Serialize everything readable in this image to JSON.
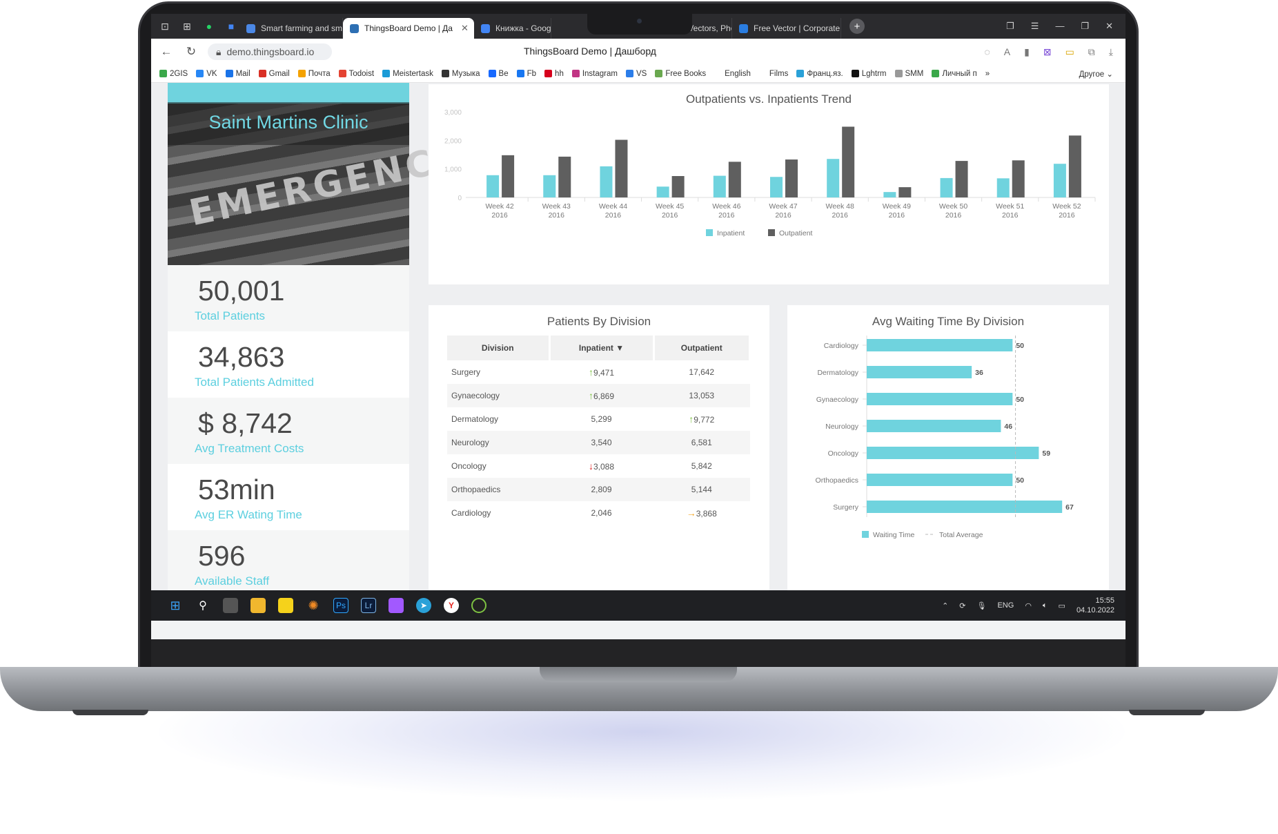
{
  "browser": {
    "tabs": [
      {
        "label": "Smart farming and smart a",
        "color": "#4b88e6"
      },
      {
        "label": "ThingsBoard Demo | Да",
        "color": "#2d6fb3"
      },
      {
        "label": "Книжка - Google",
        "color": "#4285f4"
      },
      {
        "label": "ort Vectors, Pho",
        "color": "#666"
      },
      {
        "label": "Free Vector | Corporate con",
        "color": "#2a7de1"
      }
    ],
    "url": "demo.thingsboard.io",
    "page_title": "ThingsBoard Demo | Дашборд",
    "bookmarks": [
      {
        "label": "2GIS",
        "color": "#3aa84a"
      },
      {
        "label": "VK",
        "color": "#2787f5"
      },
      {
        "label": "Mail",
        "color": "#1a73e8"
      },
      {
        "label": "Gmail",
        "color": "#d93025"
      },
      {
        "label": "Почта",
        "color": "#f4a200"
      },
      {
        "label": "Todoist",
        "color": "#e44332"
      },
      {
        "label": "Meistertask",
        "color": "#1b9bd7"
      },
      {
        "label": "Музыка",
        "color": "#333333"
      },
      {
        "label": "Be",
        "color": "#1769ff"
      },
      {
        "label": "Fb",
        "color": "#1877f2"
      },
      {
        "label": "hh",
        "color": "#d6001c"
      },
      {
        "label": "Instagram",
        "color": "#c13584"
      },
      {
        "label": "VS",
        "color": "#2b7de9"
      },
      {
        "label": "Free Books",
        "color": "#6aa84f"
      },
      {
        "label": "English",
        "color": "#ffffff"
      },
      {
        "label": "Films",
        "color": "#ffffff"
      },
      {
        "label": "Франц.яз.",
        "color": "#2aa1d8"
      },
      {
        "label": "Lghtrm",
        "color": "#111111"
      },
      {
        "label": "SMM",
        "color": "#999999"
      },
      {
        "label": "Личный п",
        "color": "#3aa84a"
      }
    ],
    "other_bookmarks": "Другое"
  },
  "clinic": {
    "title": "Saint Martins Clinic",
    "sign_text": "EMERGENCY"
  },
  "kpis": [
    {
      "value": "50,001",
      "label": "Total Patients"
    },
    {
      "value": "34,863",
      "label": "Total Patients Admitted"
    },
    {
      "value": "$ 8,742",
      "label": "Avg Treatment Costs"
    },
    {
      "value": "53min",
      "label": "Avg ER Wating Time"
    },
    {
      "value": "596",
      "label": "Available Staff"
    }
  ],
  "colors": {
    "accent": "#6fd3de",
    "outpatient": "#5f5f5f",
    "kpi_label": "#5ccfdf"
  },
  "chart_data": [
    {
      "type": "bar",
      "title": "Outpatients vs. Inpatients Trend",
      "categories": [
        "Week 42 2016",
        "Week 43 2016",
        "Week 44 2016",
        "Week 45 2016",
        "Week 46 2016",
        "Week 47 2016",
        "Week 48 2016",
        "Week 49 2016",
        "Week 50 2016",
        "Week 51 2016",
        "Week 52 2016"
      ],
      "series": [
        {
          "name": "Inpatient",
          "values": [
            780,
            780,
            1090,
            380,
            760,
            720,
            1350,
            190,
            680,
            670,
            1180
          ]
        },
        {
          "name": "Outpatient",
          "values": [
            1480,
            1430,
            2020,
            750,
            1250,
            1330,
            2480,
            360,
            1280,
            1300,
            2170
          ]
        }
      ],
      "yticks": [
        "0",
        "1,000",
        "2,000",
        "3,000"
      ],
      "ylim": [
        0,
        3000
      ],
      "legend": "bottom"
    },
    {
      "type": "bar",
      "orientation": "horizontal",
      "title": "Avg Waiting Time By Division",
      "categories": [
        "Cardiology",
        "Dermatology",
        "Gynaecology",
        "Neurology",
        "Oncology",
        "Orthopaedics",
        "Surgery"
      ],
      "series": [
        {
          "name": "Waiting Time",
          "values": [
            50,
            36,
            50,
            46,
            59,
            50,
            67
          ]
        }
      ],
      "reference_line": {
        "name": "Total Average",
        "value": 51
      },
      "xlim": [
        0,
        75
      ],
      "legend": "bottom"
    }
  ],
  "division_table": {
    "title": "Patients By Division",
    "headers": [
      "Division",
      "Inpatient ▼",
      "Outpatient"
    ],
    "rows": [
      {
        "division": "Surgery",
        "inpatient": "9,471",
        "in_arrow": "up",
        "outpatient": "17,642",
        "out_arrow": ""
      },
      {
        "division": "Gynaecology",
        "inpatient": "6,869",
        "in_arrow": "up",
        "outpatient": "13,053",
        "out_arrow": ""
      },
      {
        "division": "Dermatology",
        "inpatient": "5,299",
        "in_arrow": "",
        "outpatient": "9,772",
        "out_arrow": "up"
      },
      {
        "division": "Neurology",
        "inpatient": "3,540",
        "in_arrow": "",
        "outpatient": "6,581",
        "out_arrow": ""
      },
      {
        "division": "Oncology",
        "inpatient": "3,088",
        "in_arrow": "down",
        "outpatient": "5,842",
        "out_arrow": ""
      },
      {
        "division": "Orthopaedics",
        "inpatient": "2,809",
        "in_arrow": "",
        "outpatient": "5,144",
        "out_arrow": ""
      },
      {
        "division": "Cardiology",
        "inpatient": "2,046",
        "in_arrow": "",
        "outpatient": "3,868",
        "out_arrow": "right"
      }
    ]
  },
  "taskbar": {
    "language": "ENG",
    "time": "15:55",
    "date": "04.10.2022"
  }
}
